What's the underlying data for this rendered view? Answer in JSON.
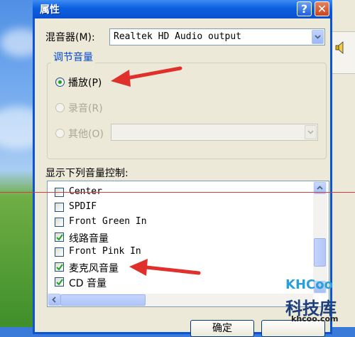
{
  "dialog": {
    "title": "属性",
    "help_glyph": "?",
    "close_glyph": "✕"
  },
  "mixer": {
    "label": "混音器(M):",
    "value": "Realtek HD Audio output"
  },
  "adjust_group": {
    "title": "调节音量",
    "options": [
      {
        "label": "播放(P)",
        "selected": true,
        "enabled": true
      },
      {
        "label": "录音(R)",
        "selected": false,
        "enabled": false
      },
      {
        "label": "其他(O)",
        "selected": false,
        "enabled": false
      }
    ]
  },
  "controls": {
    "label": "显示下列音量控制:",
    "items": [
      {
        "label": "Center",
        "checked": false
      },
      {
        "label": "SPDIF",
        "checked": false
      },
      {
        "label": "Front Green In",
        "checked": false
      },
      {
        "label": "线路音量",
        "checked": true
      },
      {
        "label": "Front Pink In",
        "checked": false
      },
      {
        "label": "麦克风音量",
        "checked": true
      },
      {
        "label": "CD 音量",
        "checked": true
      }
    ]
  },
  "buttons": {
    "ok": "确定"
  },
  "watermark": {
    "logo": "KHCoo",
    "name": "科技库",
    "url": "khcoo.com"
  },
  "colors": {
    "title_bar": "#0b5fe0",
    "dialog_bg": "#ece9d8",
    "group_title": "#0046d5",
    "annotation": "#e0302c"
  }
}
